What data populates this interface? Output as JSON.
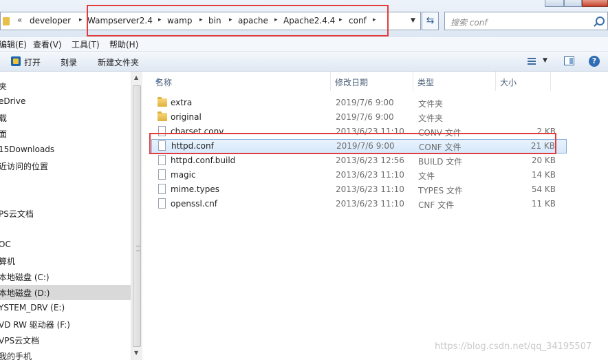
{
  "address_bar": {
    "overflow_chevron": "«",
    "crumbs": [
      "developer",
      "Wampserver2.4",
      "wamp",
      "bin",
      "apache",
      "Apache2.4.4",
      "conf"
    ],
    "separator": "▸"
  },
  "search": {
    "placeholder": "搜索 conf"
  },
  "menu": [
    "编辑(E)",
    "查看(V)",
    "工具(T)",
    "帮助(H)"
  ],
  "commands": {
    "open": "打开",
    "burn": "刻录",
    "new_folder": "新建文件夹"
  },
  "nav_pane": {
    "items": [
      "夹",
      "eDrive",
      "载",
      "面",
      "15Downloads",
      "近访问的位置",
      "",
      "",
      "PS云文档",
      "",
      "OC",
      "算机",
      "本地磁盘 (C:)",
      "本地磁盘 (D:)",
      "YSTEM_DRV (E:)",
      "VD RW 驱动器 (F:)",
      "VPS云文档",
      "我的手机"
    ],
    "selected_index": 13
  },
  "columns": {
    "name": "名称",
    "date": "修改日期",
    "type": "类型",
    "size": "大小"
  },
  "files": [
    {
      "name": "extra",
      "date": "2019/7/6 9:00",
      "type": "文件夹",
      "size": "",
      "icon": "folder"
    },
    {
      "name": "original",
      "date": "2019/7/6 9:00",
      "type": "文件夹",
      "size": "",
      "icon": "folder"
    },
    {
      "name": "charset.conv",
      "date": "2013/6/23 11:10",
      "type": "CONV 文件",
      "size": "2 KB",
      "icon": "file"
    },
    {
      "name": "httpd.conf",
      "date": "2019/7/6 9:00",
      "type": "CONF 文件",
      "size": "21 KB",
      "icon": "file"
    },
    {
      "name": "httpd.conf.build",
      "date": "2013/6/23 12:56",
      "type": "BUILD 文件",
      "size": "20 KB",
      "icon": "file"
    },
    {
      "name": "magic",
      "date": "2013/6/23 11:10",
      "type": "文件",
      "size": "14 KB",
      "icon": "file"
    },
    {
      "name": "mime.types",
      "date": "2013/6/23 11:10",
      "type": "TYPES 文件",
      "size": "54 KB",
      "icon": "file"
    },
    {
      "name": "openssl.cnf",
      "date": "2013/6/23 11:10",
      "type": "CNF 文件",
      "size": "11 KB",
      "icon": "file"
    }
  ],
  "selected_file": "httpd.conf",
  "watermark": "https://blog.csdn.net/qq_34195507",
  "colors": {
    "highlight_red": "#e23b3b",
    "selection_border": "#84acdd"
  }
}
